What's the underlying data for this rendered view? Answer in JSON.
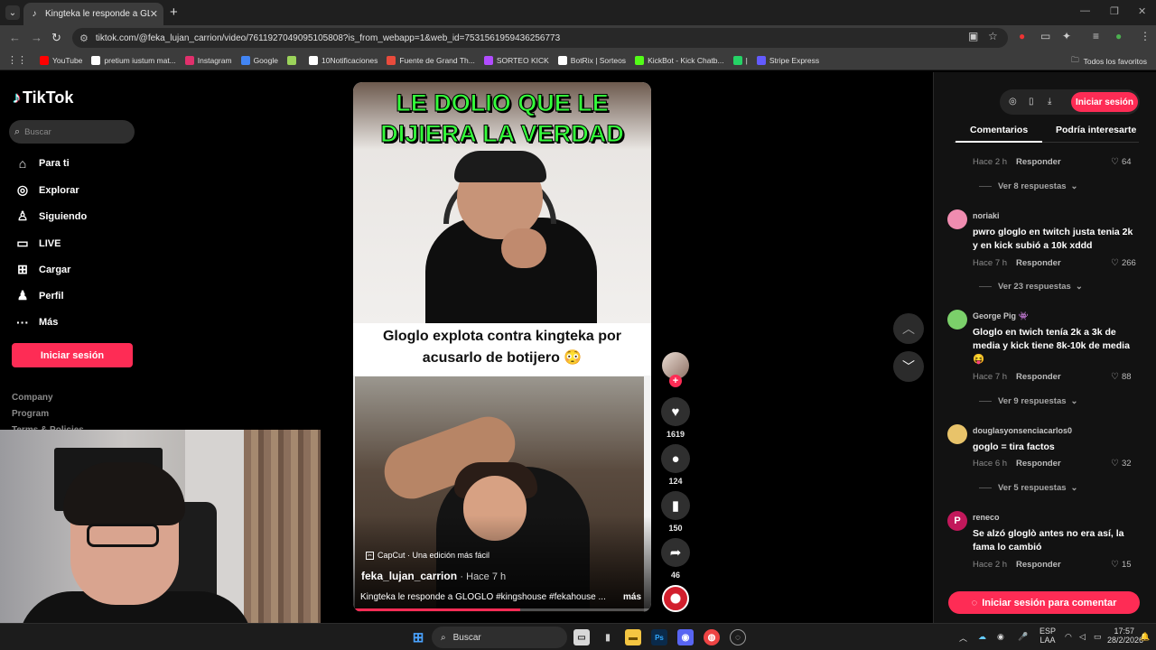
{
  "browser": {
    "tab_title": "Kingteka le responde a GLOGLO",
    "url": "tiktok.com/@feka_lujan_carrion/video/7611927049095105808?is_from_webapp=1&web_id=7531561959436256773",
    "bookmarks": [
      {
        "label": "YouTube",
        "color": "#ff0000"
      },
      {
        "label": "pretium iustum mat...",
        "color": "#ffffff"
      },
      {
        "label": "Instagram",
        "color": "#e1306c"
      },
      {
        "label": "Google",
        "color": "#4285f4"
      },
      {
        "label": "",
        "color": "#9bd35a"
      },
      {
        "label": "10Notificaciones",
        "color": "#ffffff"
      },
      {
        "label": "Fuente de Grand Th...",
        "color": "#e94b3c"
      },
      {
        "label": "SORTEO KICK",
        "color": "#b14cff"
      },
      {
        "label": "BotRix | Sorteos",
        "color": "#ffffff"
      },
      {
        "label": "KickBot - Kick Chatb...",
        "color": "#53fc18"
      },
      {
        "label": "|",
        "color": "#25d366"
      },
      {
        "label": "Stripe Express",
        "color": "#635bff"
      }
    ],
    "all_bookmarks": "Todos los favoritos"
  },
  "sidebar": {
    "logo": "TikTok",
    "search_placeholder": "Buscar",
    "items": [
      {
        "label": "Para ti",
        "icon": "home-icon"
      },
      {
        "label": "Explorar",
        "icon": "compass-icon"
      },
      {
        "label": "Siguiendo",
        "icon": "following-icon"
      },
      {
        "label": "LIVE",
        "icon": "live-icon"
      },
      {
        "label": "Cargar",
        "icon": "upload-icon"
      },
      {
        "label": "Perfil",
        "icon": "profile-icon"
      },
      {
        "label": "Más",
        "icon": "more-icon"
      }
    ],
    "login": "Iniciar sesión",
    "footer": [
      "Company",
      "Program",
      "Terms & Policies"
    ]
  },
  "video": {
    "title_overlay": "LE DOLIO QUE LE DIJIERA LA VERDAD",
    "subtitle_overlay": "Gloglo explota contra kingteka por acusarlo de botijero 😳",
    "capcut": "CapCut · Una edición más fácil",
    "author": "feka_lujan_carrion",
    "age": "· Hace 7 h",
    "caption": "Kingteka le responde a GLOGLO #kingshouse #fekahouse ...",
    "more": "más",
    "progress": 0.56
  },
  "actions": {
    "likes": "1619",
    "comments": "124",
    "saves": "150",
    "shares": "46"
  },
  "right_panel": {
    "login": "Iniciar sesión",
    "tabs": [
      "Comentarios",
      "Podría interesarte"
    ],
    "first_meta": {
      "time": "Hace 2 h",
      "reply": "Responder",
      "likes": "64"
    },
    "first_more": "Ver 8 respuestas",
    "comments": [
      {
        "user": "noriaki",
        "text": "pwro gloglo en twitch justa tenia 2k y en kick subió a 10k xddd",
        "time": "Hace 7 h",
        "reply": "Responder",
        "likes": "266",
        "more": "Ver 23 respuestas",
        "avatar": "#f08cb0"
      },
      {
        "user": "George Pig 👾",
        "text": "Gloglo en twich tenía 2k a 3k de media y kick tiene 8k-10k de media 😝",
        "time": "Hace 7 h",
        "reply": "Responder",
        "likes": "88",
        "more": "Ver 9 respuestas",
        "avatar": "#7bd06a"
      },
      {
        "user": "douglasyonsenciacarlos0",
        "text": "goglo = tira factos",
        "time": "Hace 6 h",
        "reply": "Responder",
        "likes": "32",
        "more": "Ver 5 respuestas",
        "avatar": "#e8c36a"
      },
      {
        "user": "reneco",
        "text": "Se alzó gloglò antes no era así, la fama lo cambió",
        "time": "Hace 2 h",
        "reply": "Responder",
        "likes": "15",
        "more": "",
        "avatar": "#c2185b",
        "initial": "P"
      }
    ],
    "comment_button": "Iniciar sesión para comentar"
  },
  "taskbar": {
    "search": "Buscar",
    "lang": "ESP",
    "lang2": "LAA",
    "time": "17:57",
    "date": "28/2/2026"
  }
}
